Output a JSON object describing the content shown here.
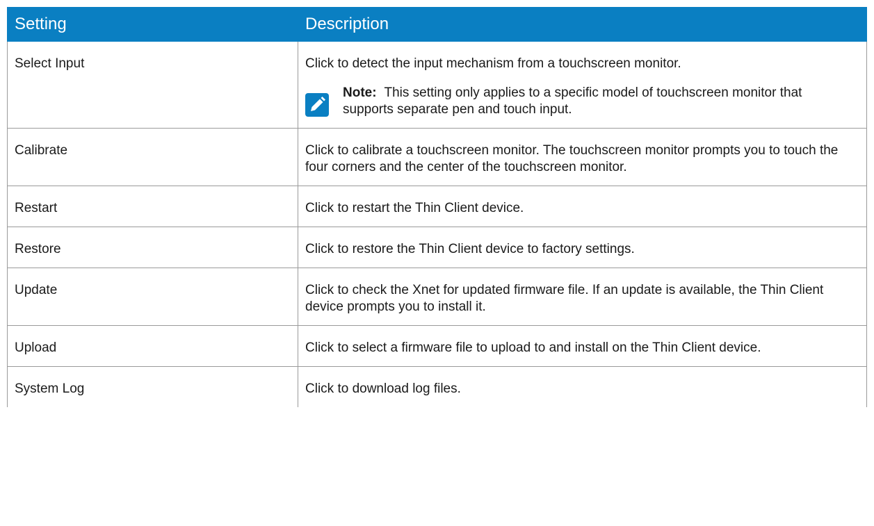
{
  "table": {
    "headers": {
      "setting": "Setting",
      "description": "Description"
    },
    "rows": [
      {
        "setting": "Select Input",
        "description": "Click to detect the input mechanism from a touchscreen monitor.",
        "note": {
          "label": "Note:",
          "text": "This setting only applies to a specific model of touchscreen monitor that supports separate pen and touch input."
        }
      },
      {
        "setting": "Calibrate",
        "description": "Click to calibrate a touchscreen monitor. The touchscreen monitor prompts you to touch the four corners and the center of the touchscreen monitor."
      },
      {
        "setting": "Restart",
        "description": "Click to restart the Thin Client device."
      },
      {
        "setting": "Restore",
        "description": "Click to restore the Thin Client device to factory settings."
      },
      {
        "setting": "Update",
        "description": "Click to check the Xnet for updated firmware file. If an update is available, the Thin Client device prompts you to install it."
      },
      {
        "setting": "Upload",
        "description": "Click to select a firmware file to upload to and install on the Thin Client device."
      },
      {
        "setting": "System Log",
        "description": "Click to download log files."
      }
    ]
  },
  "icons": {
    "note_icon": "pencil-note-icon"
  },
  "colors": {
    "header_bg": "#0a7fc2",
    "header_text": "#ffffff",
    "note_icon_bg": "#0a7fc2",
    "grid_line": "#9a9a9a"
  }
}
